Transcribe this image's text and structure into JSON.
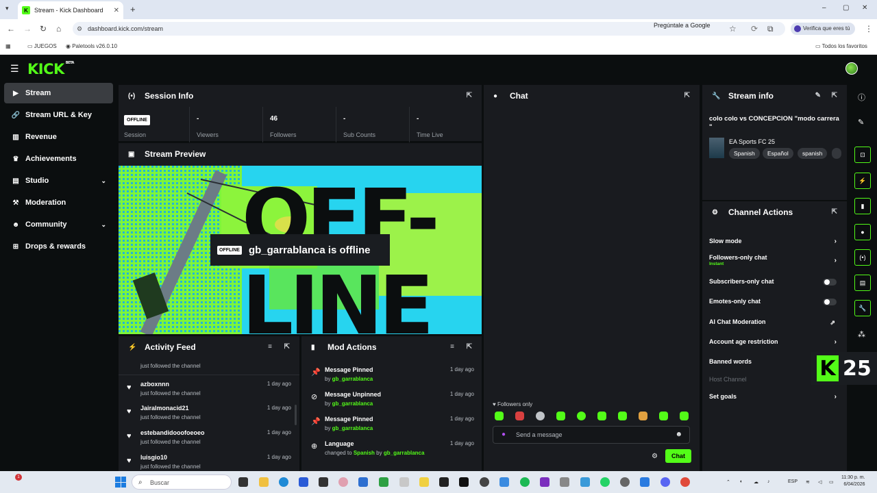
{
  "browser": {
    "tab_title": "Stream - Kick Dashboard",
    "url": "dashboard.kick.com/stream",
    "ask_google": "Pregúntale a Google",
    "verify": "Verifica que eres tú",
    "bookmarks": [
      "JUEGOS",
      "Paletools v26.0.10"
    ],
    "all_favorites": "Todos los favoritos"
  },
  "brand": {
    "logo": "KICK",
    "logo_sup": "BETA",
    "accent": "#53fc18"
  },
  "sidebar": {
    "items": [
      {
        "label": "Stream",
        "icon": "video-icon"
      },
      {
        "label": "Stream URL & Key",
        "icon": "link-icon"
      },
      {
        "label": "Revenue",
        "icon": "chart-icon"
      },
      {
        "label": "Achievements",
        "icon": "trophy-icon"
      },
      {
        "label": "Studio",
        "icon": "studio-icon"
      },
      {
        "label": "Moderation",
        "icon": "hammer-icon"
      },
      {
        "label": "Community",
        "icon": "people-icon"
      },
      {
        "label": "Drops & rewards",
        "icon": "gift-icon"
      }
    ]
  },
  "session": {
    "title": "Session Info",
    "badge": "OFFLINE",
    "session_label": "Session",
    "stats": [
      {
        "value": "-",
        "label": "Viewers"
      },
      {
        "value": "46",
        "label": "Followers"
      },
      {
        "value": "-",
        "label": "Sub Counts"
      },
      {
        "value": "-",
        "label": "Time Live"
      }
    ]
  },
  "preview": {
    "title": "Stream Preview",
    "big_text_1": "OFF-",
    "big_text_2": "LINE",
    "badge": "OFFLINE",
    "message": "gb_garrablanca is offline"
  },
  "activity": {
    "title": "Activity Feed",
    "top_partial": "just followed the channel",
    "items": [
      {
        "name": "azboxnnn",
        "sub": "just followed the channel",
        "date": "1 day ago"
      },
      {
        "name": "Jairalmonacid21",
        "sub": "just followed the channel",
        "date": "1 day ago"
      },
      {
        "name": "estebandidooofoeoeo",
        "sub": "just followed the channel",
        "date": "1 day ago"
      },
      {
        "name": "luisgio10",
        "sub": "just followed the channel",
        "date": "1 day ago"
      }
    ]
  },
  "mod": {
    "title": "Mod Actions",
    "items": [
      {
        "action": "Message Pinned",
        "by_prefix": "by ",
        "user": "gb_garrablanca",
        "date": "1 day ago"
      },
      {
        "action": "Message Unpinned",
        "by_prefix": "by ",
        "user": "gb_garrablanca",
        "date": "1 day ago"
      },
      {
        "action": "Message Pinned",
        "by_prefix": "by ",
        "user": "gb_garrablanca",
        "date": "1 day ago"
      },
      {
        "action": "Language",
        "by_prefix": "changed to ",
        "lang": "Spanish",
        "by": " by ",
        "user": "gb_garrablanca",
        "date": "1 day ago"
      }
    ]
  },
  "chat": {
    "title": "Chat",
    "followers_only": "Followers only",
    "placeholder": "Send a message",
    "send": "Chat"
  },
  "stream_info": {
    "title": "Stream info",
    "stream_title": "colo colo vs CONCEPCION \"modo carrera \"",
    "game": "EA Sports FC 25",
    "tags": [
      "Spanish",
      "Español",
      "spanish"
    ]
  },
  "channel_actions": {
    "title": "Channel Actions",
    "rows": [
      {
        "label": "Slow mode"
      },
      {
        "label": "Followers-only chat",
        "sub": "Instant"
      },
      {
        "label": "Subscribers-only chat"
      },
      {
        "label": "Emotes-only chat"
      },
      {
        "label": "AI Chat Moderation"
      },
      {
        "label": "Account age restriction"
      },
      {
        "label": "Banned words"
      },
      {
        "label": "Host Channel"
      },
      {
        "label": "Set goals"
      }
    ]
  },
  "overlay_badge": {
    "letter": "K",
    "number": "25"
  },
  "taskbar": {
    "search": "Buscar",
    "lang": "ESP",
    "time": "11:30 p. m.",
    "date": "6/04/2026",
    "notif": "1"
  }
}
